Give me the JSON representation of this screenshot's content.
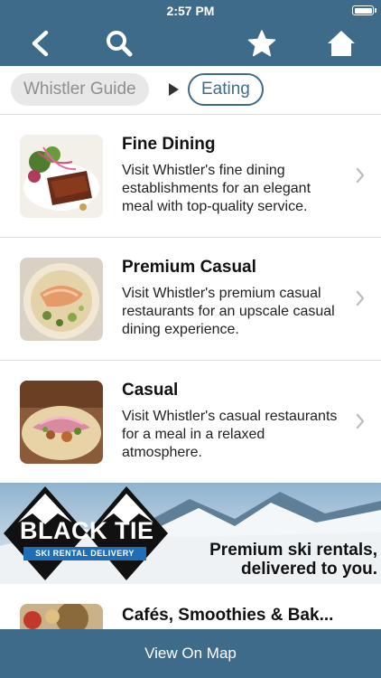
{
  "status": {
    "time": "2:57 PM"
  },
  "nav": {
    "icons": [
      "back-icon",
      "search-icon",
      "star-icon",
      "home-icon"
    ]
  },
  "breadcrumb": {
    "root": "Whistler Guide",
    "current": "Eating"
  },
  "items": [
    {
      "title": "Fine Dining",
      "description": "Visit Whistler's fine dining establishments for an elegant meal with top-quality service."
    },
    {
      "title": "Premium Casual",
      "description": "Visit Whistler's premium casual restaurants for an upscale casual dining experience."
    },
    {
      "title": "Casual",
      "description": "Visit Whistler's casual restaurants for a meal in a relaxed atmosphere."
    }
  ],
  "banner": {
    "brand": "BLACK TIE",
    "brand_sub": "SKI RENTAL DELIVERY",
    "tagline_line1": "Premium ski rentals,",
    "tagline_line2": "delivered to you."
  },
  "partial_item": {
    "title": "Cafés, Smoothies & Bak..."
  },
  "bottom": {
    "label": "View On Map"
  },
  "colors": {
    "brand": "#3f6b8a",
    "divider": "#dcdcdc"
  }
}
